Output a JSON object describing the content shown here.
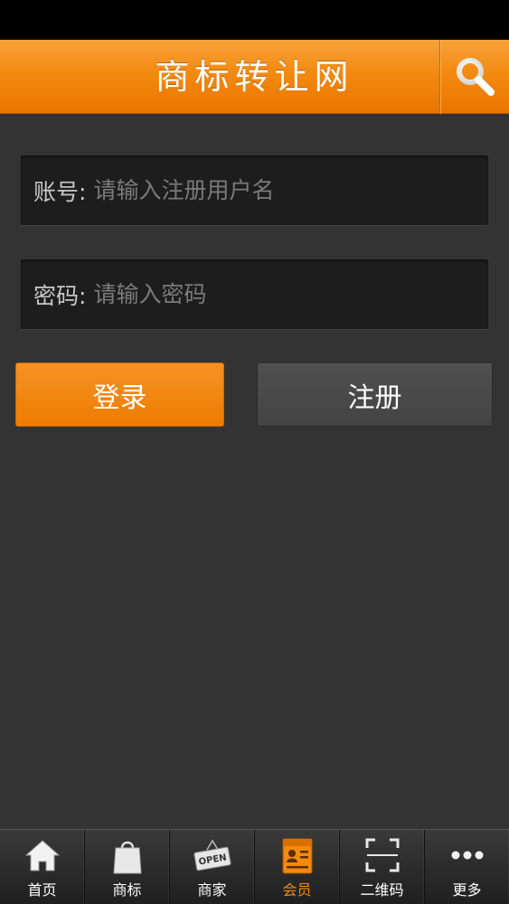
{
  "header": {
    "title": "商标转让网",
    "search_icon": "search-icon"
  },
  "form": {
    "account_label": "账号:",
    "account_placeholder": "请输入注册用户名",
    "password_label": "密码:",
    "password_placeholder": "请输入密码",
    "login_label": "登录",
    "register_label": "注册"
  },
  "tabbar": {
    "items": [
      {
        "label": "首页",
        "icon": "home-icon"
      },
      {
        "label": "商标",
        "icon": "shopping-bag-icon"
      },
      {
        "label": "商家",
        "icon": "open-sign-icon"
      },
      {
        "label": "会员",
        "icon": "member-card-icon",
        "active": true
      },
      {
        "label": "二维码",
        "icon": "qr-scan-icon"
      },
      {
        "label": "更多",
        "icon": "more-icon"
      }
    ]
  },
  "colors": {
    "accent": "#f38a10",
    "background": "#333333",
    "field_bg": "#1d1d1d"
  }
}
